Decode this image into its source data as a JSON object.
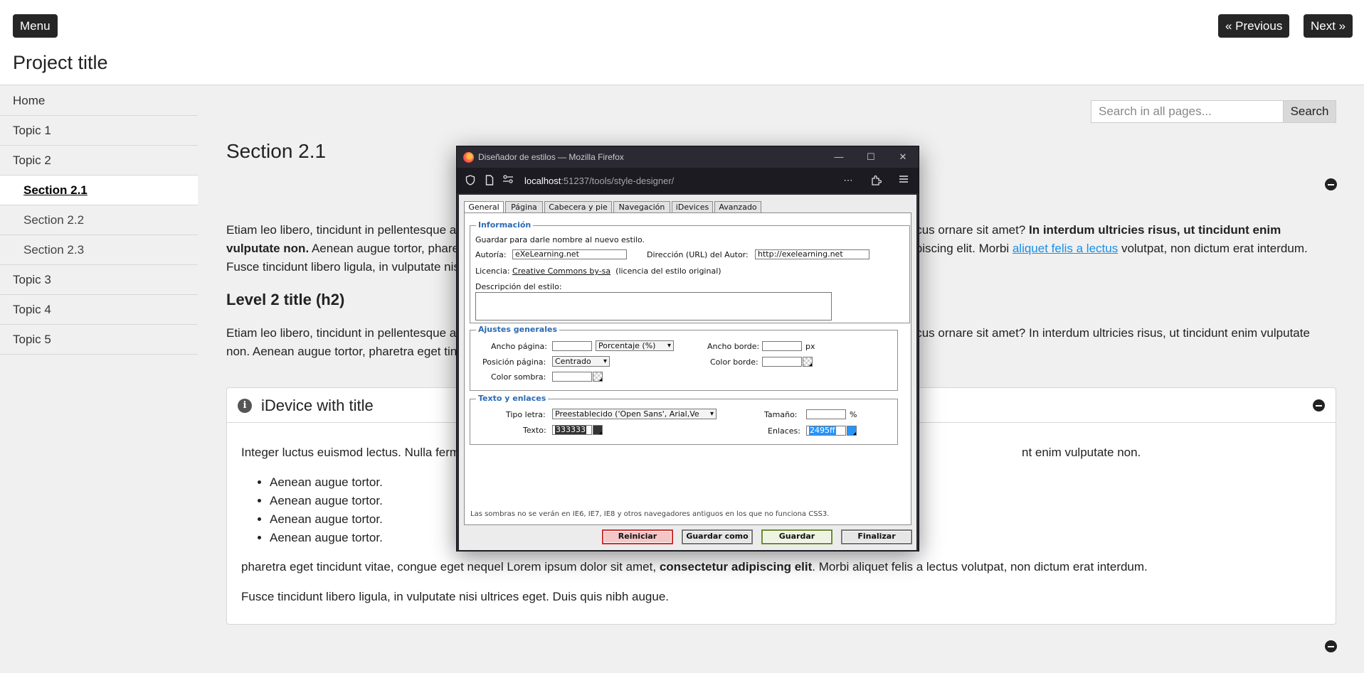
{
  "header": {
    "menu_label": "Menu",
    "prev_label": "« Previous",
    "next_label": "Next »",
    "project_title": "Project title"
  },
  "sidebar": {
    "items": [
      {
        "label": "Home"
      },
      {
        "label": "Topic 1"
      },
      {
        "label": "Topic 2"
      },
      {
        "label": "Section 2.1"
      },
      {
        "label": "Section 2.2"
      },
      {
        "label": "Section 2.3"
      },
      {
        "label": "Topic 3"
      },
      {
        "label": "Topic 4"
      },
      {
        "label": "Topic 5"
      }
    ],
    "active": "Section 2.1"
  },
  "search": {
    "placeholder": "Search in all pages...",
    "button_label": "Search"
  },
  "main": {
    "title": "Section 2.1",
    "p1_a": "Etiam leo libero, tincidunt in pellentesque a,",
    "p1_b": "lacus ornare sit amet?",
    "p1_bold": "In interdum ultricies risus, ut tincidunt enim",
    "p1_line2_bold": "vulputate non.",
    "p1_line2_a": "Aenean augue tortor, phare",
    "p1_line2_b": "ipiscing elit. Morbi",
    "p1_link": "aliquet felis a lectus",
    "p1_line2_c": "volutpat, non dictum erat interdum.",
    "p1_line3": "Fusce tincidunt libero ligula, in vulputate nisi",
    "h2": "Level 2 title (h2)",
    "p2_a": "Etiam leo libero, tincidunt in pellentesque a,",
    "p2_b": "lacus ornare sit amet? In interdum ultricies risus, ut tincidunt enim vulputate",
    "p2_line2": "non. Aenean augue tortor, pharetra eget tinc"
  },
  "idevice": {
    "title": "iDevice with title",
    "p1_a": "Integer luctus euismod lectus. Nulla ferm",
    "p1_b": "nt enim vulputate non.",
    "list": [
      "Aenean augue tortor.",
      "Aenean augue tortor.",
      "Aenean augue tortor.",
      "Aenean augue tortor."
    ],
    "p2_a": "pharetra eget tincidunt vitae, congue eget nequel Lorem ipsum dolor sit amet,",
    "p2_bold": "consectetur adipiscing elit",
    "p2_b": ". Morbi aliquet felis a lectus volutpat, non dictum erat interdum.",
    "p3": "Fusce tincidunt libero ligula, in vulputate nisi ultrices eget. Duis quis nibh augue."
  },
  "firefox": {
    "window_title": "Diseñador de estilos — Mozilla Firefox",
    "url_host": "localhost",
    "url_rest": ":51237/tools/style-designer/",
    "controls": {
      "minimize": "—",
      "maximize": "☐",
      "close": "✕"
    }
  },
  "designer": {
    "tabs": [
      "General",
      "Página",
      "Cabecera y pie",
      "Navegación",
      "iDevices",
      "Avanzado"
    ],
    "active_tab": "General",
    "info": {
      "legend": "Información",
      "hint": "Guardar para darle nombre al nuevo estilo.",
      "author_label": "Autoría:",
      "author_value": "eXeLearning.net",
      "url_label": "Dirección (URL) del Autor:",
      "url_value": "http://exelearning.net",
      "license_label": "Licencia:",
      "license_link": "Creative Commons by-sa",
      "license_note": "(licencia del estilo original)",
      "desc_label": "Descripción del estilo:"
    },
    "general": {
      "legend": "Ajustes generales",
      "page_width_label": "Ancho página:",
      "page_width_unit": "Porcentaje (%)",
      "border_width_label": "Ancho borde:",
      "border_width_unit": "px",
      "page_pos_label": "Posición página:",
      "page_pos_value": "Centrado",
      "border_color_label": "Color borde:",
      "shadow_color_label": "Color sombra:"
    },
    "text": {
      "legend": "Texto y enlaces",
      "font_label": "Tipo letra:",
      "font_value": "Preestablecido ('Open Sans', Arial,Ve",
      "size_label": "Tamaño:",
      "size_unit": "%",
      "text_label": "Texto:",
      "text_value": "333333",
      "links_label": "Enlaces:",
      "links_value": "2495ff"
    },
    "note": "Las sombras no se verán en IE6, IE7, IE8 y otros navegadores antiguos en los que no funciona CSS3.",
    "buttons": {
      "reset": "Reiniciar",
      "save_as": "Guardar como",
      "save": "Guardar",
      "finish": "Finalizar"
    }
  }
}
